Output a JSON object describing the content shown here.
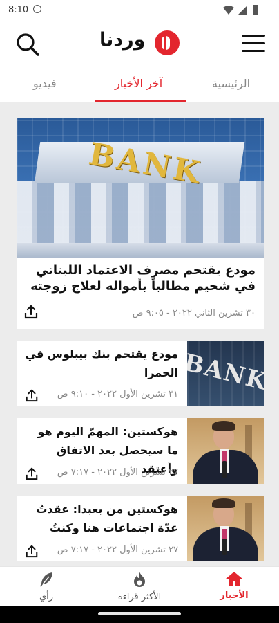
{
  "status_bar": {
    "time": "8:10"
  },
  "app": {
    "logo_text": "وردنا"
  },
  "tabs": [
    {
      "label": "الرئيسية",
      "active": false
    },
    {
      "label": "آخر الأخبار",
      "active": true
    },
    {
      "label": "فيديو",
      "active": false
    }
  ],
  "featured": {
    "image_text": "BANK",
    "title": "مودع يقتحم مصرف الاعتماد اللبناني في شحيم مطالباً بأمواله لعلاج زوجته",
    "meta": "٣٠ تشرين الثاني ٢٠٢٢ - ٩:٠٥ ص"
  },
  "articles": [
    {
      "title": "مودع يقتحم بنك بيبلوس في الحمرا",
      "meta": "٣١ تشرين الأول ٢٠٢٢ - ٩:١٠ ص",
      "thumb": "bank",
      "thumb_text": "BANK"
    },
    {
      "title": "هوكستين: المهمّ اليوم هو ما سيحصل بعد الاتفاق وأعتقد",
      "meta": "٢٧ تشرين الأول ٢٠٢٢ - ٧:١٧ ص",
      "thumb": "person"
    },
    {
      "title": "هوكستين من بعبدا: عقدتُ عدّة اجتماعات هنا وكنتُ",
      "meta": "٢٧ تشرين الأول ٢٠٢٢ - ٧:١٧ ص",
      "thumb": "person"
    }
  ],
  "bottom_nav": [
    {
      "label": "الأخبار",
      "icon": "home-icon",
      "active": true
    },
    {
      "label": "الأكثر قراءة",
      "icon": "fire-icon",
      "active": false
    },
    {
      "label": "رأي",
      "icon": "feather-icon",
      "active": false
    }
  ],
  "colors": {
    "accent": "#e3262e"
  }
}
